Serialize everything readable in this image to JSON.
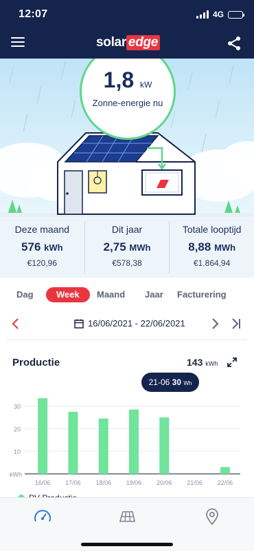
{
  "status_bar": {
    "time": "12:07",
    "network": "4G"
  },
  "header": {
    "logo_part1": "solar",
    "logo_part2": "edge",
    "menu_icon": "hamburger-menu-icon",
    "share_icon": "share-icon"
  },
  "hero": {
    "power_value": "1,8",
    "power_unit": "kW",
    "power_label": "Zonne-energie nu"
  },
  "stats": [
    {
      "title": "Deze maand",
      "value": "576",
      "unit": "kWh",
      "cost": "€120,96"
    },
    {
      "title": "Dit jaar",
      "value": "2,75",
      "unit": "MWh",
      "cost": "€578,38"
    },
    {
      "title": "Totale looptijd",
      "value": "8,88",
      "unit": "MWh",
      "cost": "€1.864,94"
    }
  ],
  "tabs": [
    {
      "label": "Dag",
      "active": false
    },
    {
      "label": "Week",
      "active": true
    },
    {
      "label": "Maand",
      "active": false
    },
    {
      "label": "Jaar",
      "active": false
    },
    {
      "label": "Facturering",
      "active": false
    }
  ],
  "date_nav": {
    "range": "16/06/2021 - 22/06/2021"
  },
  "production": {
    "title": "Productie",
    "total_value": "143",
    "total_unit": "kWh",
    "tooltip_date": "21-06",
    "tooltip_value": "30",
    "tooltip_unit": "Wh",
    "legend_label": "PV Productie"
  },
  "chart_data": {
    "type": "bar",
    "categories": [
      "16/06",
      "17/06",
      "18/06",
      "19/06",
      "20/06",
      "21/06",
      "22/06"
    ],
    "series": [
      {
        "name": "PV Productie",
        "values": [
          33.5,
          27.5,
          24.5,
          28.5,
          25,
          0.03,
          3
        ]
      }
    ],
    "ylabel": "kWh",
    "yticks": [
      10,
      20,
      30
    ],
    "ylim": [
      0,
      36
    ],
    "grid": true,
    "color": "#6fe49a"
  },
  "bottom_nav": {
    "items": [
      "dashboard-gauge-icon",
      "solar-panel-layout-icon",
      "location-pin-icon"
    ]
  },
  "colors": {
    "header": "#14244d",
    "accent": "#e8353f",
    "green": "#5fd68b"
  }
}
